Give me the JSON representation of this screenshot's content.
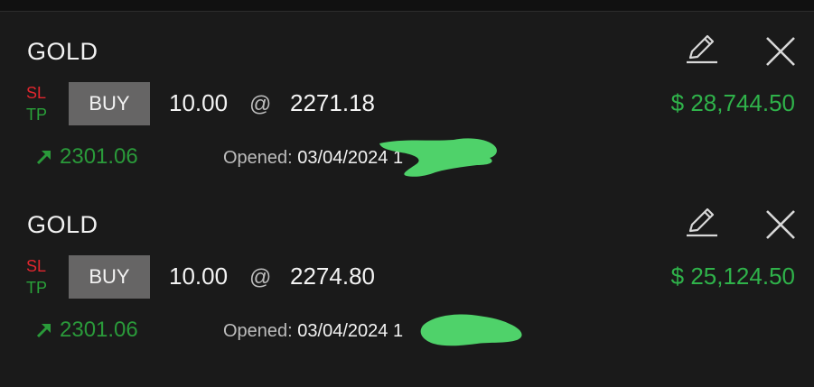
{
  "positions": [
    {
      "symbol": "GOLD",
      "sl_label": "SL",
      "tp_label": "TP",
      "side_label": "BUY",
      "volume": "10.00",
      "at_symbol": "@",
      "open_price": "2271.18",
      "profit": "$ 28,744.50",
      "current_price": "2301.06",
      "opened_label": "Opened:",
      "opened_value": "03/04/2024 1"
    },
    {
      "symbol": "GOLD",
      "sl_label": "SL",
      "tp_label": "TP",
      "side_label": "BUY",
      "volume": "10.00",
      "at_symbol": "@",
      "open_price": "2274.80",
      "profit": "$ 25,124.50",
      "current_price": "2301.06",
      "opened_label": "Opened:",
      "opened_value": "03/04/2024 1"
    }
  ],
  "colors": {
    "background": "#1a1a1a",
    "sl": "#e0262e",
    "tp": "#2aa33a",
    "profit": "#2fb24a",
    "buy_button": "#666565",
    "redaction": "#4fd26a"
  },
  "icons": {
    "edit": "pencil-edit-icon",
    "close": "close-x-icon",
    "trend": "arrow-up-right-icon"
  }
}
